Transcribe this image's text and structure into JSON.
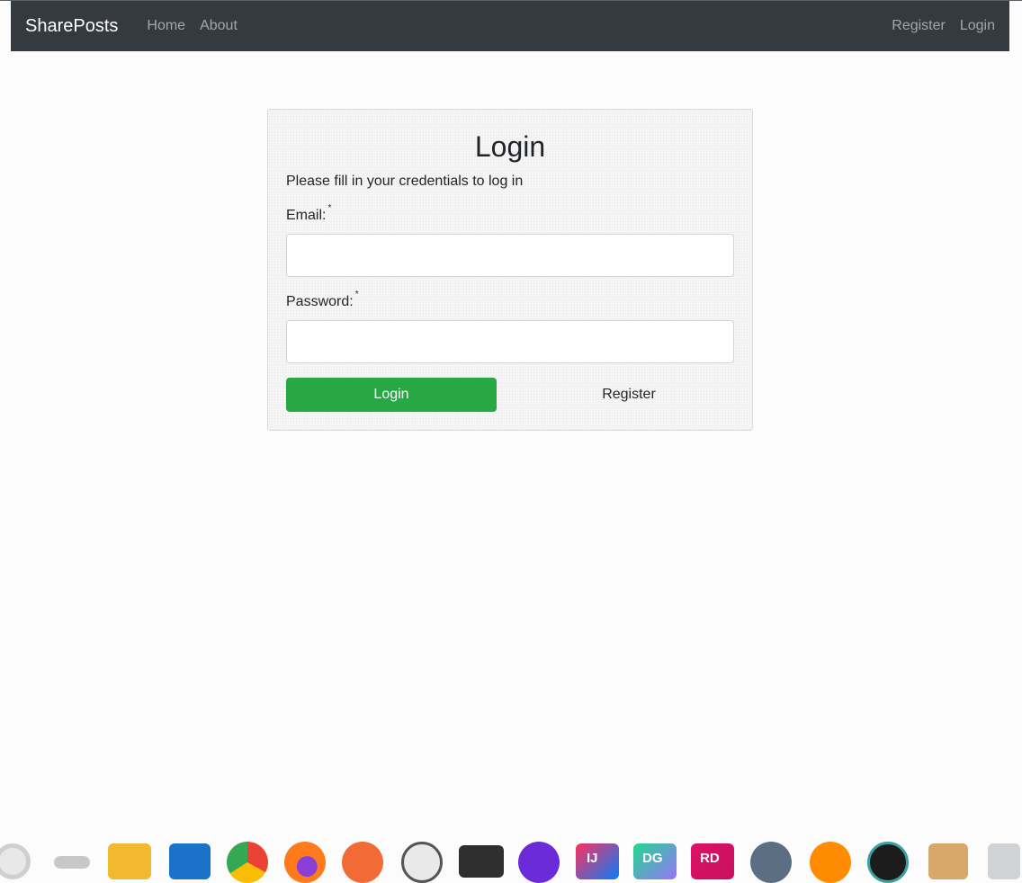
{
  "navbar": {
    "brand": "SharePosts",
    "left_links": [
      {
        "label": "Home"
      },
      {
        "label": "About"
      }
    ],
    "right_links": [
      {
        "label": "Register"
      },
      {
        "label": "Login"
      }
    ]
  },
  "login_card": {
    "title": "Login",
    "subtitle": "Please fill in your credentials to log in",
    "email": {
      "label": "Email:",
      "required_mark": "*",
      "value": "",
      "placeholder": ""
    },
    "password": {
      "label": "Password:",
      "required_mark": "*",
      "value": "",
      "placeholder": ""
    },
    "login_button": "Login",
    "register_link": "Register"
  },
  "dock": {
    "icons": [
      {
        "name": "debian-swirl-icon"
      },
      {
        "name": "dots-icon"
      },
      {
        "name": "folder-icon"
      },
      {
        "name": "mail-icon"
      },
      {
        "name": "chrome-icon"
      },
      {
        "name": "firefox-icon"
      },
      {
        "name": "paint-icon"
      },
      {
        "name": "vector-editor-icon"
      },
      {
        "name": "terminal-icon"
      },
      {
        "name": "visual-studio-icon"
      },
      {
        "name": "intellij-icon",
        "text": "IJ"
      },
      {
        "name": "datagrip-icon",
        "text": "DG"
      },
      {
        "name": "rider-icon",
        "text": "RD"
      },
      {
        "name": "settings-gear-icon"
      },
      {
        "name": "vlc-icon"
      },
      {
        "name": "camera-icon"
      },
      {
        "name": "archive-icon"
      },
      {
        "name": "trash-icon"
      }
    ]
  },
  "colors": {
    "navbar_bg": "#343a40",
    "success": "#28a745",
    "page_bg": "#fcfcfc"
  }
}
